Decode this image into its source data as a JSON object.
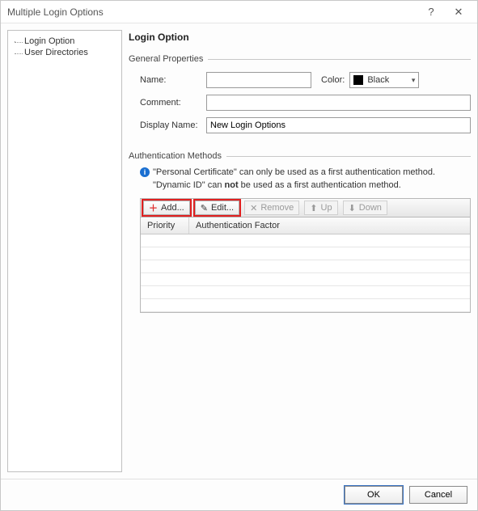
{
  "titlebar": {
    "title": "Multiple Login Options",
    "help": "?",
    "close": "✕"
  },
  "tree": {
    "items": [
      "Login Option",
      "User Directories"
    ]
  },
  "content": {
    "heading": "Login Option",
    "general": {
      "section": "General Properties",
      "name_label": "Name:",
      "name_value": "",
      "color_label": "Color:",
      "color_value": "Black",
      "comment_label": "Comment:",
      "comment_value": "",
      "display_label": "Display Name:",
      "display_value": "New Login Options"
    },
    "auth": {
      "section": "Authentication Methods",
      "info1_pre": "\"Personal Certificate\" can only be used as a first authentication method.",
      "info2_pre": "\"Dynamic ID\" can ",
      "info2_bold": "not",
      "info2_post": " be used as a first authentication method.",
      "add": "Add...",
      "edit": "Edit...",
      "remove": "Remove",
      "up": "Up",
      "down": "Down",
      "col_priority": "Priority",
      "col_factor": "Authentication Factor"
    }
  },
  "footer": {
    "ok": "OK",
    "cancel": "Cancel"
  }
}
